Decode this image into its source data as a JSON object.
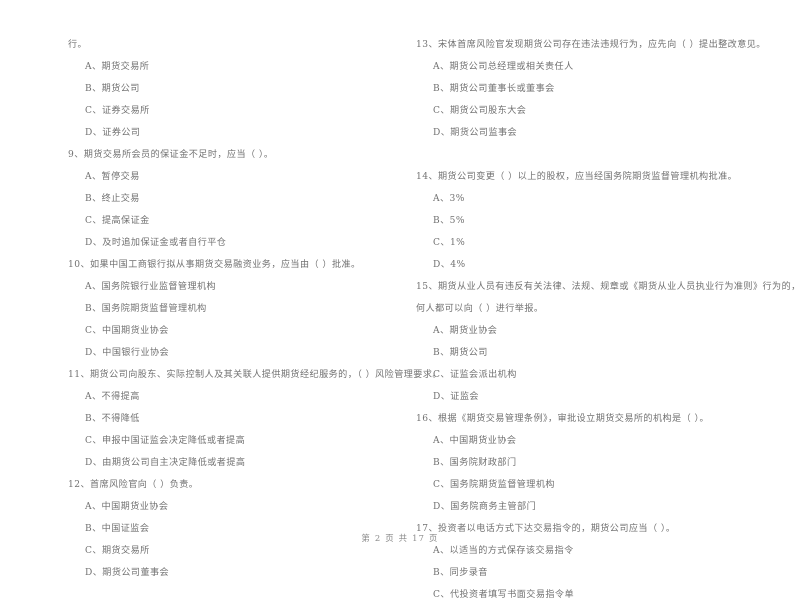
{
  "document": {
    "background_color": "#ffffff",
    "text_color": "#717171",
    "footer": "第 2 页  共 17 页"
  },
  "left_column": {
    "continuation_line": "行。",
    "blocks": [
      {
        "type": "options",
        "items": [
          "A、期货交易所",
          "B、期货公司",
          "C、证券交易所",
          "D、证券公司"
        ]
      },
      {
        "type": "question",
        "number": "9",
        "stem": "9、期货交易所会员的保证金不足时，应当（      ）。",
        "options": [
          "A、暂停交易",
          "B、终止交易",
          "C、提高保证金",
          "D、及时追加保证金或者自行平仓"
        ]
      },
      {
        "type": "question",
        "number": "10",
        "stem": "10、如果中国工商银行拟从事期货交易融资业务，应当由（      ）批准。",
        "options": [
          "A、国务院银行业监督管理机构",
          "B、国务院期货监督管理机构",
          "C、中国期货业协会",
          "D、中国银行业协会"
        ]
      },
      {
        "type": "question",
        "number": "11",
        "stem": "11、期货公司向股东、实际控制人及其关联人提供期货经纪服务的，（      ）风险管理要求。",
        "options": [
          "A、不得提高",
          "B、不得降低",
          "C、申报中国证监会决定降低或者提高",
          "D、由期货公司自主决定降低或者提高"
        ]
      },
      {
        "type": "question",
        "number": "12",
        "stem": "12、首席风险官向（      ）负责。",
        "options": [
          "A、中国期货业协会",
          "B、中国证监会",
          "C、期货交易所",
          "D、期货公司董事会"
        ]
      }
    ]
  },
  "right_column": {
    "blocks": [
      {
        "type": "question",
        "number": "13",
        "stem": "13、宋体首席风险官发现期货公司存在违法违规行为，应先向（      ）提出整改意见。",
        "options": [
          "A、期货公司总经理或相关责任人",
          "B、期货公司董事长或董事会",
          "C、期货公司股东大会",
          "D、期货公司监事会"
        ]
      },
      {
        "type": "question",
        "number": "14",
        "stem": "14、期货公司变更（      ）以上的股权，应当经国务院期货监督管理机构批准。",
        "options": [
          "A、3%",
          "B、5%",
          "C、1%",
          "D、4%"
        ]
      },
      {
        "type": "question",
        "number": "15",
        "stem_line1": "15、期货从业人员有违反有关法律、法规、规章或《期货从业人员执业行为准则》行为的，任",
        "stem_line2": "何人都可以向（      ）进行举报。",
        "options": [
          "A、期货业协会",
          "B、期货公司",
          "C、证监会派出机构",
          "D、证监会"
        ]
      },
      {
        "type": "question",
        "number": "16",
        "stem": "16、根据《期货交易管理条例》，审批设立期货交易所的机构是（      ）。",
        "options": [
          "A、中国期货业协会",
          "B、国务院财政部门",
          "C、国务院期货监督管理机构",
          "D、国务院商务主管部门"
        ]
      },
      {
        "type": "question",
        "number": "17",
        "stem": "17、投资者以电话方式下达交易指令的，期货公司应当（      ）。",
        "options": [
          "A、以适当的方式保存该交易指令",
          "B、同步录音",
          "C、代投资者填写书面交易指令单"
        ]
      }
    ]
  }
}
